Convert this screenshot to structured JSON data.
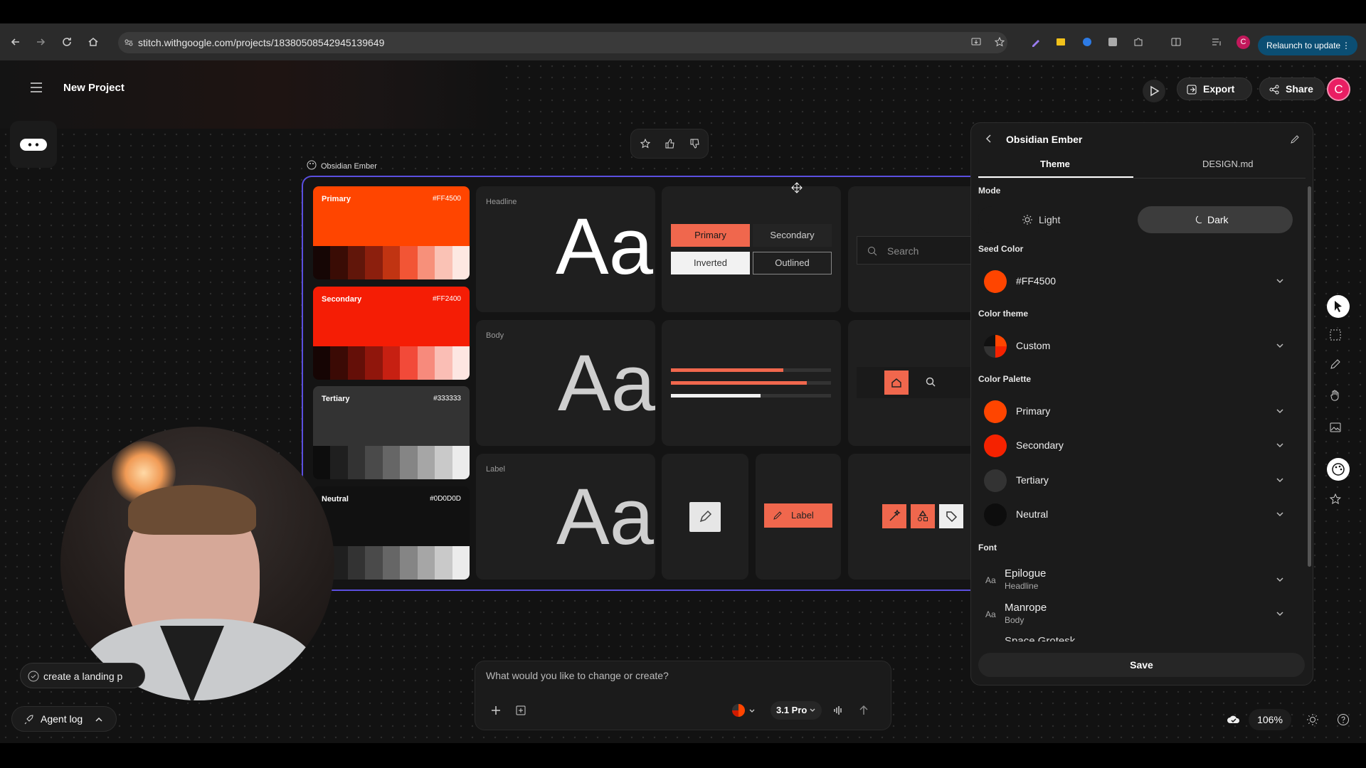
{
  "browser": {
    "url": "stitch.withgoogle.com/projects/18380508542945139649",
    "relaunch": "Relaunch to update",
    "avatar": "C"
  },
  "app": {
    "project_title": "New Project",
    "export_label": "Export",
    "share_label": "Share",
    "avatar": "C"
  },
  "board": {
    "label": "Obsidian Ember"
  },
  "palettes": [
    {
      "name": "Primary",
      "hex": "#FF4500",
      "color": "#ff4500",
      "ramp": [
        "#160605",
        "#3a0c05",
        "#61160a",
        "#8c1f0d",
        "#c13412",
        "#f25535",
        "#f7907a",
        "#fac2b5",
        "#fde8e2"
      ]
    },
    {
      "name": "Secondary",
      "hex": "#FF2400",
      "color": "#f51d05",
      "ramp": [
        "#160504",
        "#3b0a05",
        "#640f08",
        "#90160c",
        "#c72012",
        "#f24a39",
        "#f78a7c",
        "#fabeb5",
        "#fde6e2"
      ]
    },
    {
      "name": "Tertiary",
      "hex": "#333333",
      "color": "#333333",
      "ramp": [
        "#0d0d0d",
        "#1f1f1f",
        "#333",
        "#4a4a4a",
        "#666",
        "#858585",
        "#a6a6a6",
        "#c9c9c9",
        "#ececec"
      ]
    },
    {
      "name": "Neutral",
      "hex": "#0D0D0D",
      "color": "#111111",
      "ramp": [
        "#0d0d0d",
        "#1f1f1f",
        "#333",
        "#4a4a4a",
        "#666",
        "#858585",
        "#a6a6a6",
        "#c9c9c9",
        "#ececec"
      ]
    }
  ],
  "type": {
    "headline": "Headline",
    "body": "Body",
    "label": "Label",
    "sample": "Aa"
  },
  "buttons": {
    "primary": "Primary",
    "secondary": "Secondary",
    "inverted": "Inverted",
    "outlined": "Outlined",
    "label": "Label"
  },
  "search": {
    "placeholder": "Search"
  },
  "panel": {
    "title": "Obsidian Ember",
    "tabs": [
      "Theme",
      "DESIGN.md"
    ],
    "mode_heading": "Mode",
    "mode_light": "Light",
    "mode_dark": "Dark",
    "seed_heading": "Seed Color",
    "seed_value": "#FF4500",
    "theme_heading": "Color theme",
    "theme_value": "Custom",
    "palette_heading": "Color Palette",
    "palette_items": [
      "Primary",
      "Secondary",
      "Tertiary",
      "Neutral"
    ],
    "font_heading": "Font",
    "fonts": [
      {
        "name": "Epilogue",
        "role": "Headline"
      },
      {
        "name": "Manrope",
        "role": "Body"
      }
    ],
    "font_cut": "Space Grotesk",
    "save_label": "Save"
  },
  "prompt": {
    "placeholder": "What would you like to change or create?",
    "model": "3.1 Pro"
  },
  "bottom": {
    "suggestion": "create a landing p",
    "agent_log": "Agent log",
    "zoom": "106%"
  },
  "colors": {
    "accent": "#ff4500",
    "secondary": "#ff2400",
    "selection": "#5b4fe0"
  }
}
